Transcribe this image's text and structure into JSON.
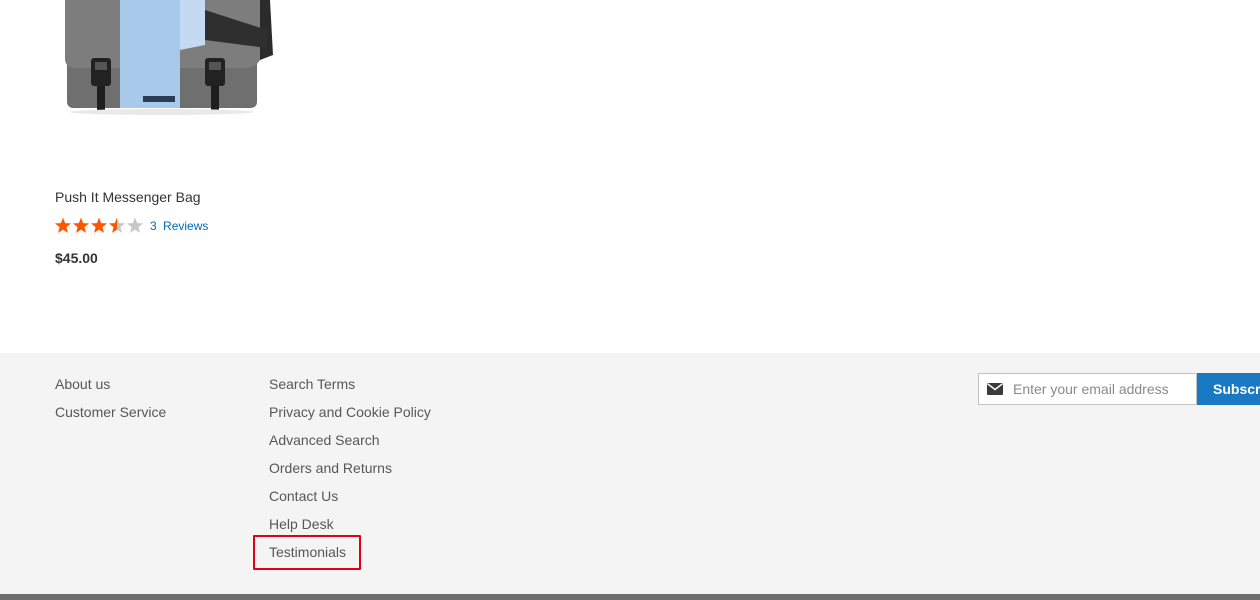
{
  "product": {
    "name": "Push It Messenger Bag",
    "rating": {
      "value": 3.5,
      "max": 5,
      "filled_color": "#ff5501",
      "empty_color": "#c7c7c7"
    },
    "reviews_count": "3",
    "reviews_label": "Reviews",
    "price": "$45.00",
    "image_icon": "messenger-bag-image"
  },
  "footer": {
    "column1": [
      {
        "label": "About us"
      },
      {
        "label": "Customer Service"
      }
    ],
    "column2": [
      {
        "label": "Search Terms"
      },
      {
        "label": "Privacy and Cookie Policy"
      },
      {
        "label": "Advanced Search"
      },
      {
        "label": "Orders and Returns"
      },
      {
        "label": "Contact Us"
      },
      {
        "label": "Help Desk"
      },
      {
        "label": "Testimonials",
        "highlighted": true
      }
    ],
    "newsletter": {
      "placeholder": "Enter your email address",
      "icon": "envelope-icon",
      "button_label": "Subscribe"
    },
    "colors": {
      "background": "#f4f4f4",
      "button": "#1979c3",
      "link": "#575757",
      "highlight": "#e0001a"
    }
  }
}
